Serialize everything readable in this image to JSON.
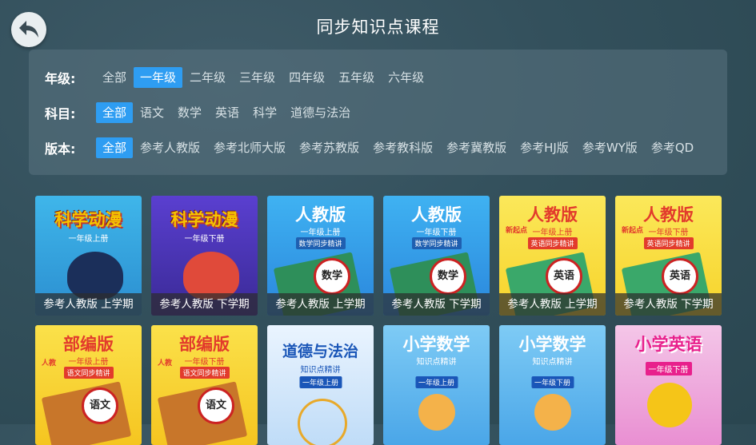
{
  "header": {
    "title": "同步知识点课程"
  },
  "filters": {
    "grade": {
      "label": "年级:",
      "options": [
        "全部",
        "一年级",
        "二年级",
        "三年级",
        "四年级",
        "五年级",
        "六年级"
      ],
      "selected": 1
    },
    "subject": {
      "label": "科目:",
      "options": [
        "全部",
        "语文",
        "数学",
        "英语",
        "科学",
        "道德与法治"
      ],
      "selected": 0
    },
    "edition": {
      "label": "版本:",
      "options": [
        "全部",
        "参考人教版",
        "参考北师大版",
        "参考苏教版",
        "参考教科版",
        "参考冀教版",
        "参考HJ版",
        "参考WY版",
        "参考QD"
      ],
      "selected": 0
    }
  },
  "courses": [
    {
      "caption": "参考人教版 上学期",
      "title": "科学动漫",
      "subtitle": "一年级上册",
      "style": "science-light"
    },
    {
      "caption": "参考人教版 下学期",
      "title": "科学动漫",
      "subtitle": "一年级下册",
      "style": "science-dark"
    },
    {
      "caption": "参考人教版 上学期",
      "title": "人教版",
      "subtitle": "一年级上册",
      "tag": "数学同步精讲",
      "badge": "数学",
      "style": "math-blue"
    },
    {
      "caption": "参考人教版 下学期",
      "title": "人教版",
      "subtitle": "一年级下册",
      "tag": "数学同步精讲",
      "badge": "数学",
      "style": "math-blue"
    },
    {
      "caption": "参考人教版 上学期",
      "title": "人教版",
      "subtitle": "一年级上册",
      "tag": "英语同步精讲",
      "badge": "英语",
      "prefix": "新起点",
      "style": "english-yellow"
    },
    {
      "caption": "参考人教版 下学期",
      "title": "人教版",
      "subtitle": "一年级下册",
      "tag": "英语同步精讲",
      "badge": "英语",
      "prefix": "新起点",
      "style": "english-yellow"
    },
    {
      "title": "部编版",
      "subtitle": "一年级上册",
      "tag": "语文同步精讲",
      "badge": "语文",
      "prefix": "人教",
      "style": "chinese-yellow"
    },
    {
      "title": "部编版",
      "subtitle": "一年级下册",
      "tag": "语文同步精讲",
      "badge": "语文",
      "prefix": "人教",
      "style": "chinese-yellow"
    },
    {
      "title": "道德与法治",
      "subtitle": "知识点精讲",
      "tag": "一年级上册",
      "style": "moral-blue"
    },
    {
      "title": "小学数学",
      "subtitle": "知识点精讲",
      "tag": "一年级上册",
      "style": "primary-math"
    },
    {
      "title": "小学数学",
      "subtitle": "知识点精讲",
      "tag": "一年级下册",
      "style": "primary-math"
    },
    {
      "title": "小学英语",
      "subtitle": "一年级下册",
      "style": "primary-english"
    }
  ],
  "colors": {
    "accent": "#2e9df2",
    "background": "#33505c"
  }
}
